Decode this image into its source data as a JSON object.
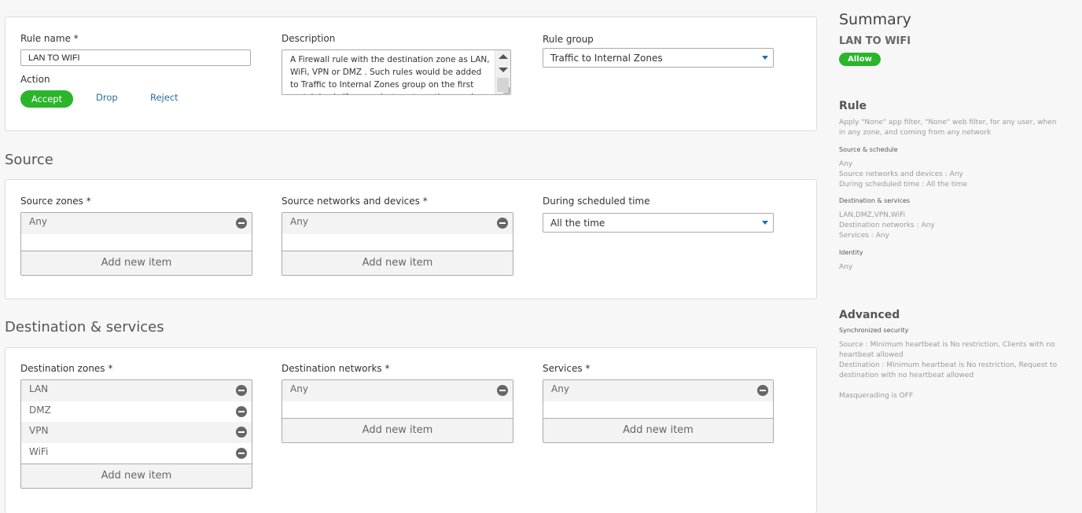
{
  "rule": {
    "rule_name_label": "Rule name *",
    "rule_name_value": "LAN TO WIFI",
    "action_label": "Action",
    "actions": [
      "Accept",
      "Drop",
      "Reject"
    ],
    "description_label": "Description",
    "description_value": "A Firewall rule with the destination zone as LAN, WiFi, VPN or DMZ . Such rules would be added to Traffic to Internal Zones group on the first match basis if user selects automatic grouping option.",
    "rule_group_label": "Rule group",
    "rule_group_value": "Traffic to Internal Zones"
  },
  "source": {
    "title": "Source",
    "zones_label": "Source zones *",
    "zones": [
      "Any"
    ],
    "networks_label": "Source networks and devices *",
    "networks": [
      "Any"
    ],
    "schedule_label": "During scheduled time",
    "schedule_value": "All the time",
    "add_new": "Add new item"
  },
  "destination": {
    "title": "Destination & services",
    "zones_label": "Destination zones *",
    "zones": [
      "LAN",
      "DMZ",
      "VPN",
      "WiFi"
    ],
    "networks_label": "Destination networks *",
    "networks": [
      "Any"
    ],
    "services_label": "Services *",
    "services": [
      "Any"
    ],
    "add_new": "Add new item"
  },
  "summary": {
    "title": "Summary",
    "rule_name": "LAN TO WIFI",
    "badge": "Allow",
    "rule_heading": "Rule",
    "rule_desc": "Apply \"None\" app filter, \"None\" web filter, for any user, when in any zone, and coming from any network",
    "source_schedule_heading": "Source & schedule",
    "source_schedule_lines": [
      "Any",
      "Source networks and devices : Any",
      "During scheduled time : All the time"
    ],
    "dest_services_heading": "Destination & services",
    "dest_services_lines": [
      "LAN,DMZ,VPN,WiFi",
      "Destination networks : Any",
      "Services : Any"
    ],
    "identity_heading": "Identity",
    "identity_lines": [
      "Any"
    ],
    "advanced_heading": "Advanced",
    "sync_heading": "Synchronized security",
    "sync_source": "Source : Minimum heartbeat is No restriction, Clients with no heartbeat allowed",
    "sync_dest": "Destination : Minimum heartbeat is No restriction, Request to destination with no heartbeat allowed",
    "masquerading": "Masquerading is OFF"
  },
  "colors": {
    "accent_green": "#2ab52a",
    "link_blue": "#2c6a9e",
    "caret_blue": "#1c6fb8"
  }
}
